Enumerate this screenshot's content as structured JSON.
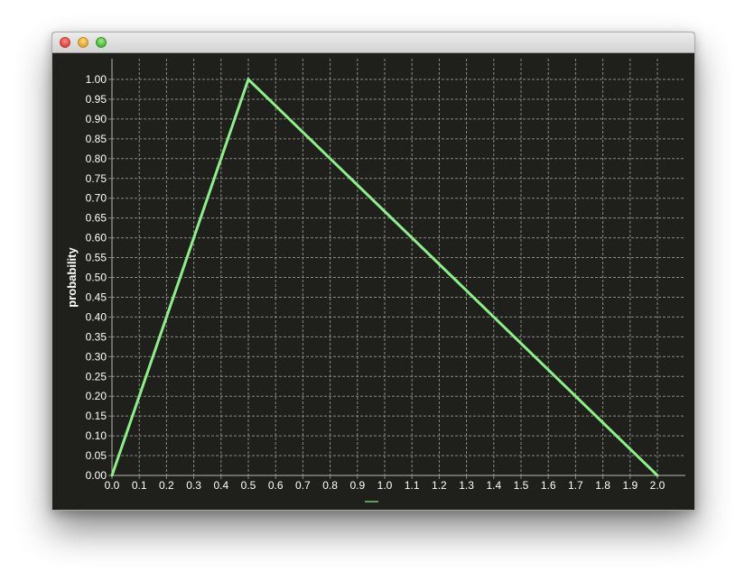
{
  "window": {
    "title": "",
    "buttons": [
      "close",
      "minimize",
      "maximize"
    ]
  },
  "colors": {
    "background": "#1f1f1b",
    "grid": "#8a8a80",
    "series": "#8cf089",
    "legend_swatch": "#5f9e5f",
    "text": "#ffffff"
  },
  "chart_data": {
    "type": "line",
    "title": "",
    "xlabel": "",
    "ylabel": "probability",
    "xlim": [
      0.0,
      2.0
    ],
    "ylim": [
      0.0,
      1.0
    ],
    "grid": true,
    "grid_style": "dashed",
    "legend_placement": "bottom-center",
    "x_ticks": [
      "0.0",
      "0.1",
      "0.2",
      "0.3",
      "0.4",
      "0.5",
      "0.6",
      "0.7",
      "0.8",
      "0.9",
      "1.0",
      "1.1",
      "1.2",
      "1.3",
      "1.4",
      "1.5",
      "1.6",
      "1.7",
      "1.8",
      "1.9",
      "2.0"
    ],
    "y_ticks": [
      "0.00",
      "0.05",
      "0.10",
      "0.15",
      "0.20",
      "0.25",
      "0.30",
      "0.35",
      "0.40",
      "0.45",
      "0.50",
      "0.55",
      "0.60",
      "0.65",
      "0.70",
      "0.75",
      "0.80",
      "0.85",
      "0.90",
      "0.95",
      "1.00"
    ],
    "series": [
      {
        "x": [
          0.0,
          0.5,
          2.0
        ],
        "y": [
          0.0,
          1.0,
          0.0
        ]
      }
    ]
  }
}
